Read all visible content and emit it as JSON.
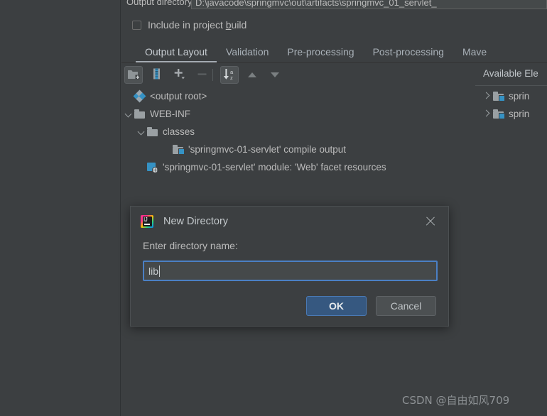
{
  "panel": {
    "output_directory_label": "Output directory:",
    "output_directory_value": "D:\\javacode\\springmvc\\out\\artifacts\\springmvc_01_servlet_",
    "include_in_project_build": {
      "label_before": "Include in project ",
      "label_mnemonic": "b",
      "label_after": "uild",
      "checked": false
    },
    "tabs": [
      {
        "label": "Output Layout",
        "active": true
      },
      {
        "label": "Validation",
        "active": false
      },
      {
        "label": "Pre-processing",
        "active": false
      },
      {
        "label": "Post-processing",
        "active": false
      },
      {
        "label": "Mave",
        "active": false
      }
    ],
    "toolbar": {
      "buttons": [
        {
          "name": "create-directory-icon",
          "pressed": true
        },
        {
          "name": "create-archive-icon",
          "pressed": false
        },
        {
          "name": "add-icon",
          "pressed": false
        },
        {
          "name": "remove-icon",
          "pressed": false
        },
        {
          "name": "sort-alphabetically-icon",
          "pressed": true
        },
        {
          "name": "move-up-icon",
          "pressed": false
        },
        {
          "name": "move-down-icon",
          "pressed": false
        }
      ]
    },
    "available_elements_title": "Available Ele",
    "output_tree": [
      {
        "label": "<output root>",
        "icon": "artifact-icon",
        "indent": 1,
        "expander": "none"
      },
      {
        "label": "WEB-INF",
        "icon": "folder-icon",
        "indent": 1,
        "expander": "expanded"
      },
      {
        "label": "classes",
        "icon": "folder-icon",
        "indent": 2,
        "expander": "expanded"
      },
      {
        "label": "'springmvc-01-servlet' compile output",
        "icon": "compile-output-icon",
        "indent": 4,
        "expander": "none"
      },
      {
        "label": "'springmvc-01-servlet' module: 'Web' facet resources",
        "icon": "web-facet-icon",
        "indent": 2,
        "expander": "none"
      }
    ],
    "available_tree": [
      {
        "label": "sprin",
        "icon": "compile-output-icon",
        "expander": "collapsed"
      },
      {
        "label": "sprin",
        "icon": "compile-output-icon",
        "expander": "collapsed"
      }
    ]
  },
  "dialog": {
    "title": "New Directory",
    "logo_text": "IJ",
    "close_label": "×",
    "field_label": "Enter directory name:",
    "field_value": "lib",
    "field_placeholder": "",
    "ok_label": "OK",
    "cancel_label": "Cancel"
  },
  "watermark": "CSDN @自由如风709",
  "colors": {
    "background": "#3c3f41",
    "accent_blue": "#3592c4",
    "primary_button": "#365880",
    "focus_border": "#4b80c4",
    "text": "#bbbbbb"
  }
}
